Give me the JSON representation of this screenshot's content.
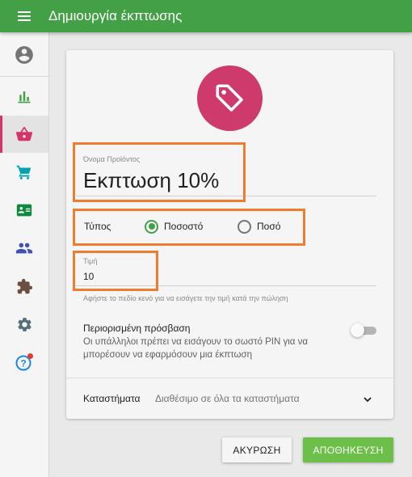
{
  "appbar": {
    "title": "Δημιουργία έκπτωσης"
  },
  "sidebar": {
    "items": [
      {
        "icon": "account-circle-icon",
        "color": "#757575"
      },
      {
        "icon": "bar-chart-icon",
        "color": "#43a047"
      },
      {
        "icon": "shopping-basket-icon",
        "color": "#d6336c",
        "active": true
      },
      {
        "icon": "cart-icon",
        "color": "#00a3b4"
      },
      {
        "icon": "id-card-icon",
        "color": "#0e8a3e"
      },
      {
        "icon": "people-icon",
        "color": "#3f51b5"
      },
      {
        "icon": "puzzle-icon",
        "color": "#6d4c41"
      },
      {
        "icon": "gear-icon",
        "color": "#546e7a"
      },
      {
        "icon": "help-icon",
        "color": "#1e88e5",
        "badge_color": "#e53935"
      }
    ]
  },
  "form": {
    "name_label": "Όνομα Προϊόντος",
    "name_value": "Εκπτωση 10%",
    "type_label": "Τύπος",
    "type_options": [
      {
        "label": "Ποσοστό",
        "checked": true
      },
      {
        "label": "Ποσό",
        "checked": false
      }
    ],
    "price_label": "Τιμή",
    "price_value": "10",
    "price_hint": "Αφήστε το πεδίο κενό για να εισάγετε την τιμή κατά την πώληση",
    "restricted_title": "Περιορισμένη πρόσβαση",
    "restricted_desc": "Οι υπάλληλοι πρέπει να εισάγουν το σωστό PIN για να μπορέσουν να εφαρμόσουν μια έκπτωση",
    "restricted_enabled": false,
    "stores_label": "Καταστήματα",
    "stores_value": "Διαθέσιμο σε όλα τα καταστήματα"
  },
  "buttons": {
    "cancel": "ΑΚΥΡΩΣΗ",
    "save": "ΑΠΟΘΗΚΕΥΣΗ"
  },
  "colors": {
    "appbar": "#43a047",
    "tag_circle": "#cf3a6d",
    "highlight": "#ed7d31",
    "radio_checked": "#43a047",
    "save_button": "#6cc04a"
  }
}
